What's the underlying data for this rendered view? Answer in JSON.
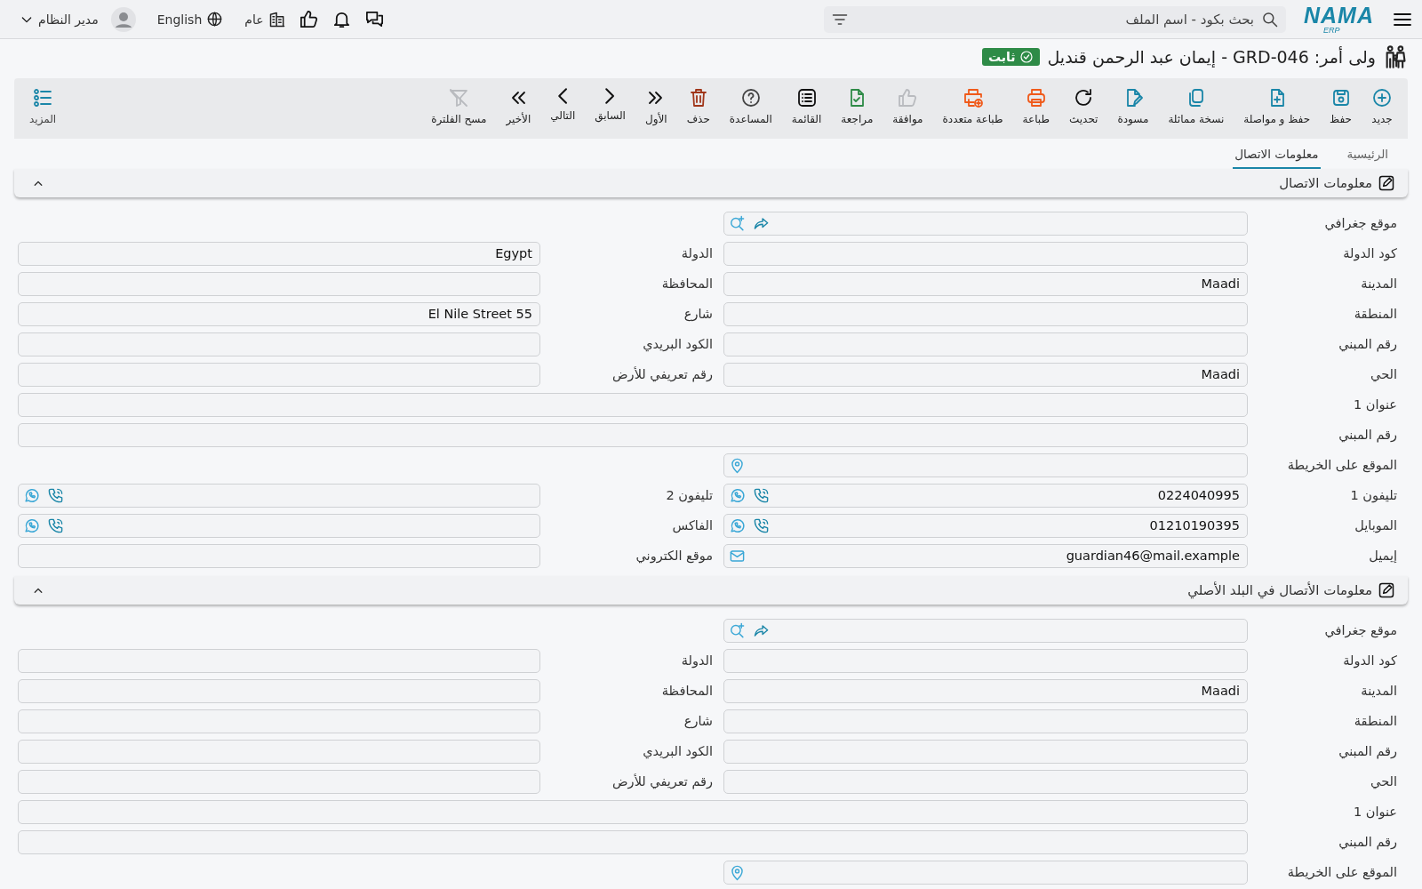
{
  "topbar": {
    "logo": {
      "name": "NAMA",
      "suffix": "ERP"
    },
    "search": {
      "placeholder": "بحث بكود - اسم الملف"
    },
    "branch": "عام",
    "language": "English",
    "user": "مدير النظام"
  },
  "title": {
    "text": "ولى أمر: GRD-046 - إيمان عبد الرحمن قنديل",
    "status": "ثابت"
  },
  "toolbar": [
    {
      "kind": "new",
      "label": "جديد",
      "disabled": false
    },
    {
      "kind": "save",
      "label": "حفظ",
      "disabled": false
    },
    {
      "kind": "save_continue",
      "label": "حفظ و مواصلة",
      "disabled": false
    },
    {
      "kind": "copy",
      "label": "نسخة مماثلة",
      "disabled": false
    },
    {
      "kind": "draft",
      "label": "مسودة",
      "disabled": false
    },
    {
      "kind": "refresh",
      "label": "تحديث",
      "disabled": false
    },
    {
      "kind": "print",
      "label": "طباعة",
      "disabled": false
    },
    {
      "kind": "multi_print",
      "label": "طباعة متعددة",
      "disabled": false
    },
    {
      "kind": "approve",
      "label": "موافقة",
      "disabled": true
    },
    {
      "kind": "review",
      "label": "مراجعة",
      "disabled": false
    },
    {
      "kind": "list",
      "label": "القائمة",
      "disabled": false
    },
    {
      "kind": "help",
      "label": "المساعدة",
      "disabled": false
    },
    {
      "kind": "delete",
      "label": "حذف",
      "disabled": false
    },
    {
      "kind": "first",
      "label": "الأول",
      "disabled": false
    },
    {
      "kind": "previous",
      "label": "السابق",
      "disabled": false
    },
    {
      "kind": "next",
      "label": "التالي",
      "disabled": false
    },
    {
      "kind": "last",
      "label": "الأخير",
      "disabled": false
    },
    {
      "kind": "clear_filter",
      "label": "مسح الفلترة",
      "disabled": true
    },
    {
      "kind": "more",
      "label": "المزيد",
      "disabled": false
    }
  ],
  "tabs": [
    {
      "label": "الرئيسية",
      "selected": false
    },
    {
      "label": "معلومات الاتصال",
      "selected": true
    }
  ],
  "sections": [
    {
      "title": "معلومات الاتصال",
      "expanded": true,
      "rows": [
        {
          "kind": "half",
          "fields": [
            {
              "label": "موقع جغرافي",
              "kind": "geo"
            }
          ]
        },
        {
          "kind": "pair",
          "fields": [
            {
              "label": "كود الدولة",
              "kind": "text"
            },
            {
              "label": "الدولة",
              "kind": "text",
              "value": "Egypt"
            }
          ]
        },
        {
          "kind": "pair",
          "fields": [
            {
              "label": "المدينة",
              "kind": "text",
              "value": "Maadi"
            },
            {
              "label": "المحافظة",
              "kind": "text"
            }
          ]
        },
        {
          "kind": "pair",
          "fields": [
            {
              "label": "المنطقة",
              "kind": "text"
            },
            {
              "label": "شارع",
              "kind": "text",
              "value": "El Nile Street 55"
            }
          ]
        },
        {
          "kind": "pair",
          "fields": [
            {
              "label": "رقم المبني",
              "kind": "text"
            },
            {
              "label": "الكود البريدي",
              "kind": "text"
            }
          ]
        },
        {
          "kind": "pair",
          "fields": [
            {
              "label": "الحي",
              "kind": "text",
              "value": "Maadi"
            },
            {
              "label": "رقم تعريفي للأرض",
              "kind": "text"
            }
          ]
        },
        {
          "kind": "wide",
          "fields": [
            {
              "label": "عنوان 1",
              "kind": "text"
            }
          ]
        },
        {
          "kind": "wide",
          "fields": [
            {
              "label": "رقم المبني",
              "kind": "text"
            }
          ]
        },
        {
          "kind": "half",
          "fields": [
            {
              "label": "الموقع على الخريطة",
              "kind": "map"
            }
          ]
        },
        {
          "kind": "pair",
          "fields": [
            {
              "label": "تليفون 1",
              "kind": "phone",
              "value": "0224040995"
            },
            {
              "label": "تليفون 2",
              "kind": "phone"
            }
          ]
        },
        {
          "kind": "pair",
          "fields": [
            {
              "label": "الموبايل",
              "kind": "phone",
              "value": "01210190395"
            },
            {
              "label": "الفاكس",
              "kind": "phone"
            }
          ]
        },
        {
          "kind": "pair",
          "fields": [
            {
              "label": "إيميل",
              "kind": "email",
              "value": "guardian46@mail.example"
            },
            {
              "label": "موقع الكتروني",
              "kind": "text"
            }
          ]
        }
      ]
    },
    {
      "title": "معلومات الأتصال في البلد الأصلي",
      "expanded": true,
      "rows": [
        {
          "kind": "half",
          "fields": [
            {
              "label": "موقع جغرافي",
              "kind": "geo"
            }
          ]
        },
        {
          "kind": "pair",
          "fields": [
            {
              "label": "كود الدولة",
              "kind": "text"
            },
            {
              "label": "الدولة",
              "kind": "text"
            }
          ]
        },
        {
          "kind": "pair",
          "fields": [
            {
              "label": "المدينة",
              "kind": "text",
              "value": "Maadi"
            },
            {
              "label": "المحافظة",
              "kind": "text"
            }
          ]
        },
        {
          "kind": "pair",
          "fields": [
            {
              "label": "المنطقة",
              "kind": "text"
            },
            {
              "label": "شارع",
              "kind": "text"
            }
          ]
        },
        {
          "kind": "pair",
          "fields": [
            {
              "label": "رقم المبني",
              "kind": "text"
            },
            {
              "label": "الكود البريدي",
              "kind": "text"
            }
          ]
        },
        {
          "kind": "pair",
          "fields": [
            {
              "label": "الحي",
              "kind": "text"
            },
            {
              "label": "رقم تعريفي للأرض",
              "kind": "text"
            }
          ]
        },
        {
          "kind": "wide",
          "fields": [
            {
              "label": "عنوان 1",
              "kind": "text"
            }
          ]
        },
        {
          "kind": "wide",
          "fields": [
            {
              "label": "رقم المبني",
              "kind": "text"
            }
          ]
        },
        {
          "kind": "half",
          "fields": [
            {
              "label": "الموقع على الخريطة",
              "kind": "map"
            }
          ]
        }
      ]
    }
  ]
}
